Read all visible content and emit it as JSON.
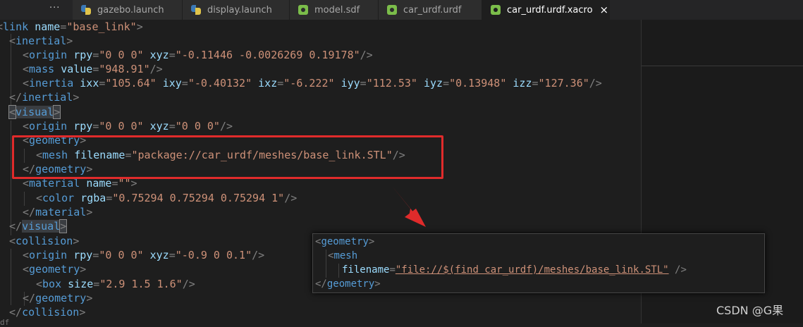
{
  "tabs": [
    {
      "label": "gazebo.launch",
      "icon": "python-icon"
    },
    {
      "label": "display.launch",
      "icon": "python-icon"
    },
    {
      "label": "model.sdf",
      "icon": "xml-gear-icon"
    },
    {
      "label": "car_urdf.urdf",
      "icon": "xml-gear-icon"
    },
    {
      "label": "car_urdf.urdf.xacro",
      "icon": "xml-gear-icon",
      "active": true
    }
  ],
  "overflow_dots": "···",
  "close_glyph": "×",
  "code": {
    "l1": {
      "a": "link",
      "b": "name",
      "c": "\"base_link\""
    },
    "l2": {
      "a": "inertial"
    },
    "l3": {
      "a": "origin",
      "b": "rpy",
      "c": "\"0 0 0\"",
      "d": "xyz",
      "e": "\"-0.11446 -0.0026269 0.19178\""
    },
    "l4": {
      "a": "mass",
      "b": "value",
      "c": "\"948.91\""
    },
    "l5": {
      "a": "inertia",
      "b": "ixx",
      "c": "\"105.64\"",
      "d": "ixy",
      "e": "\"-0.40132\"",
      "f": "ixz",
      "g": "\"-6.222\"",
      "h": "iyy",
      "i": "\"112.53\"",
      "j": "iyz",
      "k": "\"0.13948\"",
      "l": "izz",
      "m": "\"127.36\""
    },
    "l6": {
      "a": "inertial"
    },
    "l7": {
      "a": "visual"
    },
    "l8": {
      "a": "origin",
      "b": "rpy",
      "c": "\"0 0 0\"",
      "d": "xyz",
      "e": "\"0 0 0\""
    },
    "l9": {
      "a": "geometry"
    },
    "l10": {
      "a": "mesh",
      "b": "filename",
      "c": "\"package://car_urdf/meshes/base_link.STL\""
    },
    "l11": {
      "a": "geometry"
    },
    "l12": {
      "a": "material",
      "b": "name",
      "c": "\"\""
    },
    "l13": {
      "a": "color",
      "b": "rgba",
      "c": "\"0.75294 0.75294 0.75294 1\""
    },
    "l14": {
      "a": "material"
    },
    "l15": {
      "a": "visual"
    },
    "l16": {
      "a": "collision"
    },
    "l17": {
      "a": "origin",
      "b": "rpy",
      "c": "\"0 0 0\"",
      "d": "xyz",
      "e": "\"-0.9 0 0.1\""
    },
    "l18": {
      "a": "geometry"
    },
    "l19": {
      "a": "box",
      "b": "size",
      "c": "\"2.9 1.5 1.6\""
    },
    "l20": {
      "a": "geometry"
    },
    "l21": {
      "a": "collision"
    }
  },
  "popup": {
    "p1": {
      "a": "geometry"
    },
    "p2": {
      "a": "mesh"
    },
    "p3": {
      "b": "filename",
      "c": "\"file://$(find car_urdf)/meshes/base_link.STL\""
    },
    "p4": {
      "a": "geometry"
    }
  },
  "colors": {
    "tag": "#569cd6",
    "attr": "#9cdcfe",
    "string": "#ce9178",
    "annotation": "#e02b2b"
  },
  "watermark": "CSDN @G果",
  "bottom_fragment": "df"
}
